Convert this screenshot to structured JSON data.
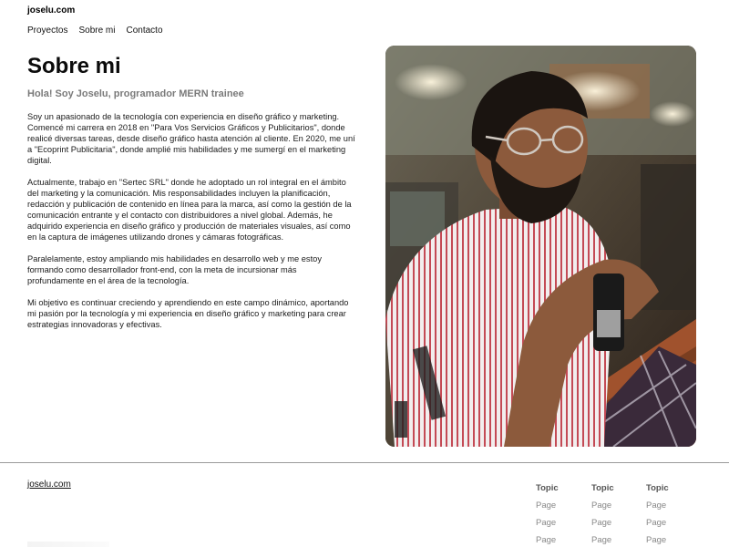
{
  "header": {
    "logo": "joselu.com",
    "nav": [
      "Proyectos",
      "Sobre mi",
      "Contacto"
    ]
  },
  "main": {
    "title": "Sobre mi",
    "subtitle": "Hola! Soy Joselu, programador MERN trainee",
    "paragraphs": [
      "Soy un apasionado de la tecnología con experiencia en diseño gráfico y marketing. Comencé mi carrera en 2018 en \"Para Vos Servicios Gráficos y Publicitarios\", donde realicé diversas tareas, desde diseño gráfico hasta atención al cliente. En 2020, me uní a \"Ecoprint Publicitaria\", donde amplié mis habilidades y me sumergí en el marketing digital.",
      "Actualmente, trabajo en \"Sertec SRL\" donde he adoptado un rol integral en el ámbito del marketing y la comunicación. Mis responsabilidades incluyen la planificación, redacción y publicación de contenido en línea para la marca, así como la gestión de la comunicación entrante y el contacto con distribuidores a nivel global. Además, he adquirido experiencia en diseño gráfico y producción de materiales visuales, así como en la captura de imágenes utilizando drones y cámaras fotográficas.",
      "Paralelamente, estoy ampliando mis habilidades en desarrollo web y me estoy formando como desarrollador front-end, con la meta de incursionar más profundamente en el área de la tecnología.",
      "Mi objetivo es continuar creciendo y aprendiendo en este campo dinámico, aportando mi pasión por la tecnología y mi experiencia en diseño gráfico y marketing para crear estrategias innovadoras y efectivas."
    ]
  },
  "footer": {
    "link": "joselu.com",
    "columns": [
      {
        "topic": "Topic",
        "pages": [
          "Page",
          "Page",
          "Page"
        ]
      },
      {
        "topic": "Topic",
        "pages": [
          "Page",
          "Page",
          "Page"
        ]
      },
      {
        "topic": "Topic",
        "pages": [
          "Page",
          "Page",
          "Page"
        ]
      }
    ]
  },
  "colors": {
    "text": "#111111",
    "subtitle": "#7a7a7a",
    "divider": "#9a9a9a",
    "footer_topic": "#555555",
    "footer_page": "#888888"
  }
}
